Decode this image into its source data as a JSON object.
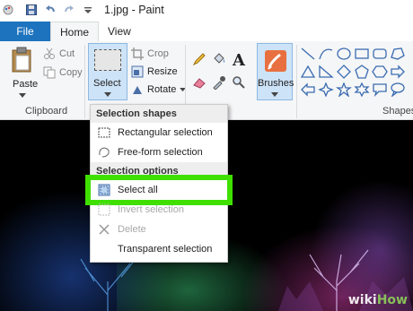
{
  "window": {
    "title": "1.jpg - Paint"
  },
  "tabs": {
    "file": "File",
    "home": "Home",
    "view": "View"
  },
  "ribbon": {
    "clipboard": {
      "paste": "Paste",
      "cut": "Cut",
      "copy": "Copy",
      "group": "Clipboard"
    },
    "image": {
      "select": "Select",
      "crop": "Crop",
      "resize": "Resize",
      "rotate": "Rotate"
    },
    "brushes": "Brushes",
    "shapes_group": "Shapes"
  },
  "select_menu": {
    "shapes_header": "Selection shapes",
    "rectangular": "Rectangular selection",
    "freeform": "Free-form selection",
    "options_header": "Selection options",
    "select_all": "Select all",
    "invert": "Invert selection",
    "delete": "Delete",
    "transparent": "Transparent selection"
  },
  "watermark": {
    "wiki": "wiki",
    "how": "How"
  },
  "colors": {
    "file_tab": "#1e73be",
    "highlight": "#3fe000",
    "ribbon": "#f5f6f7",
    "select_active": "#cde3f7"
  }
}
